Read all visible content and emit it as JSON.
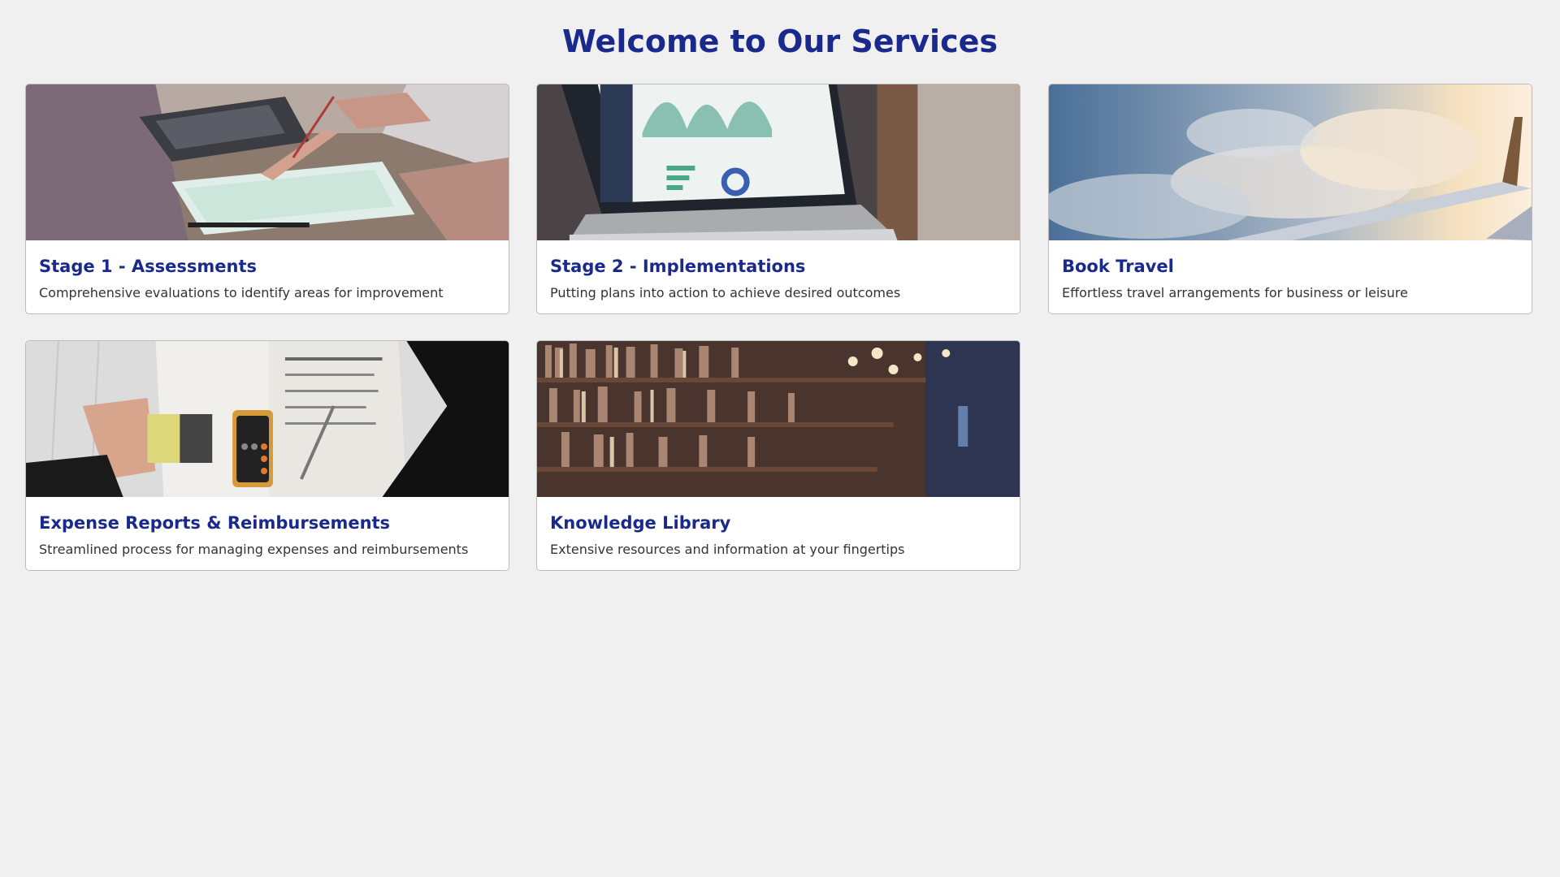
{
  "page": {
    "title": "Welcome to Our Services"
  },
  "colors": {
    "background": "#f0f0f0",
    "title": "#1a2a8c",
    "card_border": "#bdbdbd",
    "description_text": "#333333"
  },
  "cards": [
    {
      "title": "Stage 1 - Assessments",
      "description": "Comprehensive evaluations to identify areas for improvement",
      "image": "business-meeting-photo"
    },
    {
      "title": "Stage 2 - Implementations",
      "description": "Putting plans into action to achieve desired outcomes",
      "image": "laptop-dashboard-photo"
    },
    {
      "title": "Book Travel",
      "description": "Effortless travel arrangements for business or leisure",
      "image": "airplane-wing-photo"
    },
    {
      "title": "Expense Reports & Reimbursements",
      "description": "Streamlined process for managing expenses and reimbursements",
      "image": "tax-forms-calculator-photo"
    },
    {
      "title": "Knowledge Library",
      "description": "Extensive resources and information at your fingertips",
      "image": "library-bookshelves-photo"
    }
  ]
}
